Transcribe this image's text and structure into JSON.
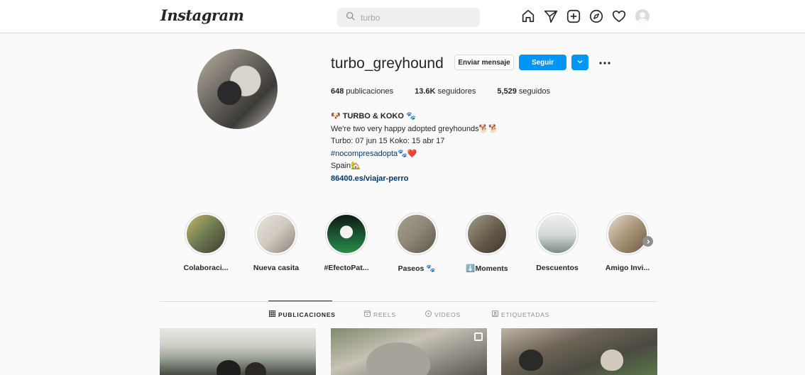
{
  "topbar": {
    "logo": "Instagram",
    "search": {
      "value": "turbo"
    },
    "icons": [
      "home-icon",
      "direct-icon",
      "new-post-icon",
      "explore-icon",
      "activity-heart-icon",
      "profile-avatar"
    ]
  },
  "profile": {
    "username": "turbo_greyhound",
    "message_button": "Enviar mensaje",
    "follow_button": "Seguir",
    "stats": {
      "posts_count": "648",
      "posts_label": "publicaciones",
      "followers_count": "13.6K",
      "followers_label": "seguidores",
      "following_count": "5,529",
      "following_label": "seguidos"
    },
    "bio": {
      "name": "🐶 TURBO & KOKO 🐾",
      "line1": "We're two very happy adopted greyhounds🐕🐕",
      "line2": "Turbo: 07 jun 15 Koko: 15 abr 17",
      "hashtag": "#nocompresadopta",
      "hashtag_suffix": "🐾❤️",
      "location": "Spain🏡",
      "link": "86400.es/viajar-perro"
    }
  },
  "highlights": [
    {
      "label": "Colaboraci...",
      "color": "#6b7a52"
    },
    {
      "label": "Nueva casita",
      "color": "#cfc9c0"
    },
    {
      "label": "#EfectoPat...",
      "color": "#1f6b3a"
    },
    {
      "label": "Paseos 🐾",
      "color": "#8d8676"
    },
    {
      "label": "⬇️Moments",
      "color": "#6b5f4d"
    },
    {
      "label": "Descuentos",
      "color": "#d7dcd9"
    },
    {
      "label": "Amigo Invi...",
      "color": "#a89478"
    }
  ],
  "tabs": [
    {
      "label": "PUBLICACIONES",
      "active": true
    },
    {
      "label": "REELS",
      "active": false
    },
    {
      "label": "VÍDEOS",
      "active": false
    },
    {
      "label": "ETIQUETADAS",
      "active": false
    }
  ],
  "colors": {
    "accent": "#0095f6",
    "link": "#00376b",
    "border": "#dbdbdb"
  }
}
